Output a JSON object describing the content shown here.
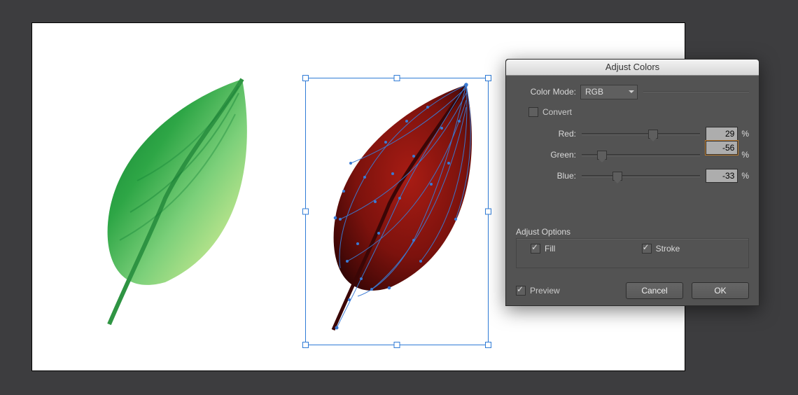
{
  "dialog": {
    "title": "Adjust Colors",
    "colorModeLabel": "Color Mode:",
    "colorModeValue": "RGB",
    "convertLabel": "Convert",
    "convertChecked": false,
    "channels": [
      {
        "label": "Red:",
        "value": "29",
        "thumbPct": 60,
        "highlighted": false
      },
      {
        "label": "Green:",
        "value": "-56",
        "thumbPct": 17,
        "highlighted": true
      },
      {
        "label": "Blue:",
        "value": "-33",
        "thumbPct": 30,
        "highlighted": false
      }
    ],
    "percent": "%",
    "adjustOptionsLabel": "Adjust Options",
    "fillLabel": "Fill",
    "fillChecked": true,
    "strokeLabel": "Stroke",
    "strokeChecked": true,
    "previewLabel": "Preview",
    "previewChecked": true,
    "cancel": "Cancel",
    "ok": "OK"
  }
}
